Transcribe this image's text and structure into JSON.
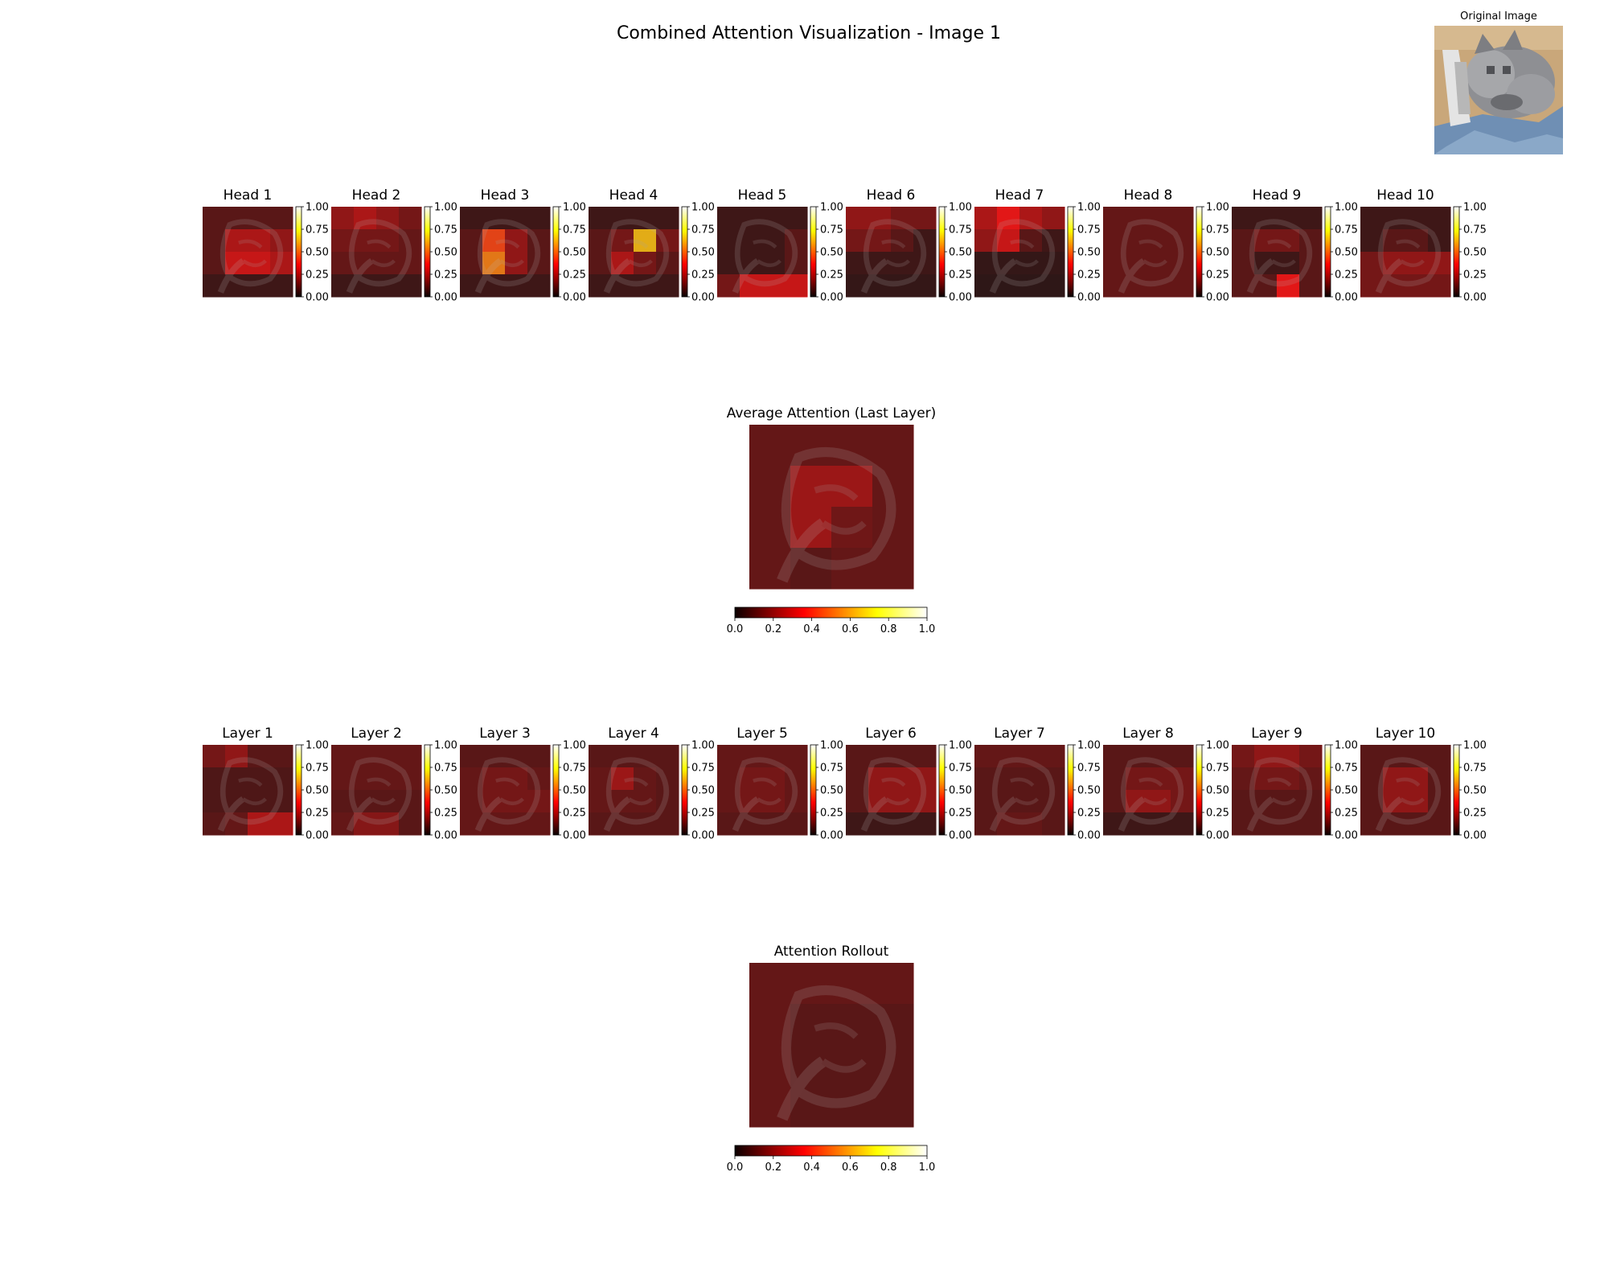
{
  "figure": {
    "title": "Combined Attention Visualization - Image 1"
  },
  "original": {
    "title": "Original Image"
  },
  "colorbar": {
    "small_ticks": [
      "0.00",
      "0.25",
      "0.50",
      "0.75",
      "1.00"
    ],
    "large_ticks": [
      "0.0",
      "0.2",
      "0.4",
      "0.6",
      "0.8",
      "1.0"
    ]
  },
  "chart_data": [
    {
      "type": "heatmap",
      "group": "heads",
      "panels": [
        {
          "title": "Head 1",
          "grid": [
            [
              0.1,
              0.1,
              0.1,
              0.1
            ],
            [
              0.1,
              0.25,
              0.25,
              0.2
            ],
            [
              0.1,
              0.3,
              0.3,
              0.25
            ],
            [
              0.05,
              0.05,
              0.05,
              0.05
            ]
          ],
          "vrange": [
            0,
            1
          ]
        },
        {
          "title": "Head 2",
          "grid": [
            [
              0.2,
              0.25,
              0.2,
              0.15
            ],
            [
              0.15,
              0.15,
              0.15,
              0.12
            ],
            [
              0.12,
              0.12,
              0.12,
              0.12
            ],
            [
              0.05,
              0.05,
              0.05,
              0.05
            ]
          ],
          "vrange": [
            0,
            1
          ]
        },
        {
          "title": "Head 3",
          "grid": [
            [
              0.05,
              0.05,
              0.05,
              0.05
            ],
            [
              0.1,
              0.45,
              0.2,
              0.1
            ],
            [
              0.1,
              0.55,
              0.2,
              0.1
            ],
            [
              0.05,
              0.05,
              0.05,
              0.05
            ]
          ],
          "vrange": [
            0,
            1
          ]
        },
        {
          "title": "Head 4",
          "grid": [
            [
              0.05,
              0.05,
              0.05,
              0.05
            ],
            [
              0.1,
              0.15,
              0.65,
              0.15
            ],
            [
              0.1,
              0.25,
              0.15,
              0.1
            ],
            [
              0.05,
              0.05,
              0.05,
              0.05
            ]
          ],
          "vrange": [
            0,
            1
          ]
        },
        {
          "title": "Head 5",
          "grid": [
            [
              0.05,
              0.05,
              0.05,
              0.05
            ],
            [
              0.05,
              0.05,
              0.05,
              0.1
            ],
            [
              0.05,
              0.05,
              0.05,
              0.1
            ],
            [
              0.15,
              0.3,
              0.3,
              0.3
            ]
          ],
          "vrange": [
            0,
            1
          ]
        },
        {
          "title": "Head 6",
          "grid": [
            [
              0.2,
              0.2,
              0.15,
              0.15
            ],
            [
              0.15,
              0.15,
              0.1,
              0.05
            ],
            [
              0.05,
              0.05,
              0.05,
              0.05
            ],
            [
              0.03,
              0.03,
              0.03,
              0.03
            ]
          ],
          "vrange": [
            0,
            1
          ]
        },
        {
          "title": "Head 7",
          "grid": [
            [
              0.25,
              0.35,
              0.25,
              0.2
            ],
            [
              0.2,
              0.3,
              0.1,
              0.05
            ],
            [
              0.03,
              0.03,
              0.03,
              0.03
            ],
            [
              0.02,
              0.02,
              0.02,
              0.02
            ]
          ],
          "vrange": [
            0,
            1
          ]
        },
        {
          "title": "Head 8",
          "grid": [
            [
              0.12,
              0.12,
              0.12,
              0.12
            ],
            [
              0.12,
              0.12,
              0.12,
              0.12
            ],
            [
              0.12,
              0.12,
              0.12,
              0.12
            ],
            [
              0.12,
              0.12,
              0.12,
              0.12
            ]
          ],
          "vrange": [
            0,
            1
          ]
        },
        {
          "title": "Head 9",
          "grid": [
            [
              0.05,
              0.05,
              0.05,
              0.05
            ],
            [
              0.1,
              0.15,
              0.15,
              0.1
            ],
            [
              0.1,
              0.05,
              0.05,
              0.1
            ],
            [
              0.1,
              0.1,
              0.35,
              0.1
            ]
          ],
          "vrange": [
            0,
            1
          ]
        },
        {
          "title": "Head 10",
          "grid": [
            [
              0.05,
              0.05,
              0.05,
              0.05
            ],
            [
              0.05,
              0.1,
              0.1,
              0.05
            ],
            [
              0.15,
              0.2,
              0.2,
              0.2
            ],
            [
              0.15,
              0.15,
              0.15,
              0.15
            ]
          ],
          "vrange": [
            0,
            1
          ]
        }
      ]
    },
    {
      "type": "heatmap",
      "group": "average",
      "panels": [
        {
          "title": "Average Attention (Last Layer)",
          "grid": [
            [
              0.12,
              0.12,
              0.12,
              0.12
            ],
            [
              0.12,
              0.22,
              0.22,
              0.12
            ],
            [
              0.12,
              0.22,
              0.14,
              0.12
            ],
            [
              0.12,
              0.1,
              0.12,
              0.12
            ]
          ],
          "vrange": [
            0,
            1
          ]
        }
      ]
    },
    {
      "type": "heatmap",
      "group": "layers",
      "panels": [
        {
          "title": "Layer 1",
          "grid": [
            [
              0.15,
              0.2,
              0.1,
              0.1
            ],
            [
              0.08,
              0.08,
              0.08,
              0.08
            ],
            [
              0.08,
              0.08,
              0.08,
              0.08
            ],
            [
              0.1,
              0.12,
              0.25,
              0.25
            ]
          ],
          "vrange": [
            0,
            1
          ]
        },
        {
          "title": "Layer 2",
          "grid": [
            [
              0.12,
              0.12,
              0.12,
              0.12
            ],
            [
              0.12,
              0.12,
              0.12,
              0.12
            ],
            [
              0.1,
              0.1,
              0.1,
              0.1
            ],
            [
              0.12,
              0.18,
              0.18,
              0.1
            ]
          ],
          "vrange": [
            0,
            1
          ]
        },
        {
          "title": "Layer 3",
          "grid": [
            [
              0.1,
              0.1,
              0.1,
              0.1
            ],
            [
              0.12,
              0.15,
              0.15,
              0.12
            ],
            [
              0.12,
              0.15,
              0.15,
              0.15
            ],
            [
              0.12,
              0.12,
              0.12,
              0.12
            ]
          ],
          "vrange": [
            0,
            1
          ]
        },
        {
          "title": "Layer 4",
          "grid": [
            [
              0.1,
              0.1,
              0.1,
              0.1
            ],
            [
              0.12,
              0.22,
              0.12,
              0.1
            ],
            [
              0.12,
              0.12,
              0.12,
              0.1
            ],
            [
              0.1,
              0.1,
              0.1,
              0.1
            ]
          ],
          "vrange": [
            0,
            1
          ]
        },
        {
          "title": "Layer 5",
          "grid": [
            [
              0.12,
              0.12,
              0.12,
              0.12
            ],
            [
              0.12,
              0.15,
              0.15,
              0.12
            ],
            [
              0.12,
              0.15,
              0.15,
              0.12
            ],
            [
              0.1,
              0.1,
              0.1,
              0.1
            ]
          ],
          "vrange": [
            0,
            1
          ]
        },
        {
          "title": "Layer 6",
          "grid": [
            [
              0.1,
              0.1,
              0.1,
              0.1
            ],
            [
              0.1,
              0.2,
              0.2,
              0.2
            ],
            [
              0.1,
              0.2,
              0.2,
              0.2
            ],
            [
              0.05,
              0.05,
              0.05,
              0.05
            ]
          ],
          "vrange": [
            0,
            1
          ]
        },
        {
          "title": "Layer 7",
          "grid": [
            [
              0.12,
              0.12,
              0.12,
              0.12
            ],
            [
              0.1,
              0.1,
              0.1,
              0.1
            ],
            [
              0.1,
              0.1,
              0.1,
              0.1
            ],
            [
              0.1,
              0.12,
              0.12,
              0.1
            ]
          ],
          "vrange": [
            0,
            1
          ]
        },
        {
          "title": "Layer 8",
          "grid": [
            [
              0.1,
              0.1,
              0.1,
              0.1
            ],
            [
              0.1,
              0.15,
              0.15,
              0.15
            ],
            [
              0.1,
              0.2,
              0.2,
              0.15
            ],
            [
              0.05,
              0.05,
              0.05,
              0.05
            ]
          ],
          "vrange": [
            0,
            1
          ]
        },
        {
          "title": "Layer 9",
          "grid": [
            [
              0.15,
              0.2,
              0.2,
              0.15
            ],
            [
              0.12,
              0.15,
              0.15,
              0.12
            ],
            [
              0.1,
              0.1,
              0.1,
              0.1
            ],
            [
              0.1,
              0.1,
              0.1,
              0.1
            ]
          ],
          "vrange": [
            0,
            1
          ]
        },
        {
          "title": "Layer 10",
          "grid": [
            [
              0.1,
              0.1,
              0.1,
              0.1
            ],
            [
              0.1,
              0.2,
              0.2,
              0.1
            ],
            [
              0.1,
              0.2,
              0.2,
              0.1
            ],
            [
              0.1,
              0.1,
              0.1,
              0.1
            ]
          ],
          "vrange": [
            0,
            1
          ]
        }
      ]
    },
    {
      "type": "heatmap",
      "group": "rollout",
      "panels": [
        {
          "title": "Attention Rollout",
          "grid": [
            [
              0.12,
              0.12,
              0.12,
              0.12
            ],
            [
              0.12,
              0.1,
              0.1,
              0.1
            ],
            [
              0.12,
              0.1,
              0.1,
              0.1
            ],
            [
              0.12,
              0.1,
              0.1,
              0.1
            ]
          ],
          "vrange": [
            0,
            1
          ]
        }
      ]
    }
  ]
}
